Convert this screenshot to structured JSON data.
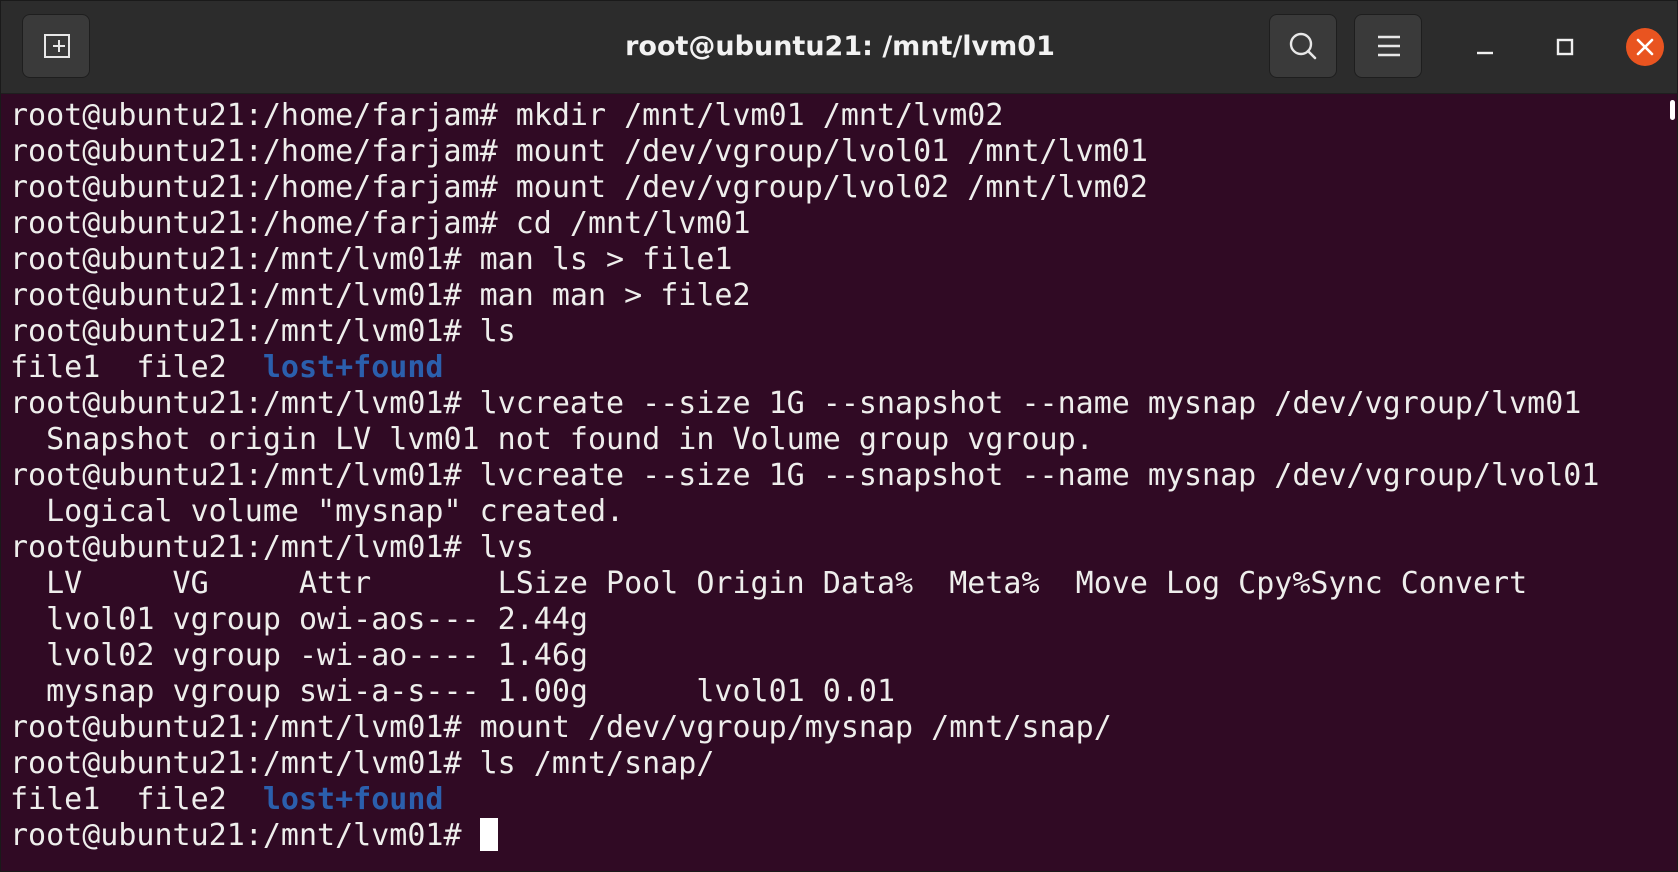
{
  "window": {
    "title": "root@ubuntu21: /mnt/lvm01"
  },
  "titlebar": {
    "new_tab_icon": "new-tab-icon",
    "search_icon": "search-icon",
    "menu_icon": "hamburger-menu-icon",
    "minimize_icon": "minimize-icon",
    "maximize_icon": "maximize-icon",
    "close_icon": "close-icon",
    "close_color": "#e95420"
  },
  "terminal": {
    "background": "#300a24",
    "foreground": "#eeeeec",
    "directory_color": "#2b5fad",
    "lines": [
      {
        "segments": [
          {
            "text": "root@ubuntu21:/home/farjam# mkdir /mnt/lvm01 /mnt/lvm02"
          }
        ]
      },
      {
        "segments": [
          {
            "text": "root@ubuntu21:/home/farjam# mount /dev/vgroup/lvol01 /mnt/lvm01"
          }
        ]
      },
      {
        "segments": [
          {
            "text": "root@ubuntu21:/home/farjam# mount /dev/vgroup/lvol02 /mnt/lvm02"
          }
        ]
      },
      {
        "segments": [
          {
            "text": "root@ubuntu21:/home/farjam# cd /mnt/lvm01"
          }
        ]
      },
      {
        "segments": [
          {
            "text": "root@ubuntu21:/mnt/lvm01# man ls > file1"
          }
        ]
      },
      {
        "segments": [
          {
            "text": "root@ubuntu21:/mnt/lvm01# man man > file2"
          }
        ]
      },
      {
        "segments": [
          {
            "text": "root@ubuntu21:/mnt/lvm01# ls"
          }
        ]
      },
      {
        "segments": [
          {
            "text": "file1  file2  "
          },
          {
            "text": "lost+found",
            "dir": true
          }
        ]
      },
      {
        "segments": [
          {
            "text": "root@ubuntu21:/mnt/lvm01# lvcreate --size 1G --snapshot --name mysnap /dev/vgroup/lvm01"
          }
        ]
      },
      {
        "segments": [
          {
            "text": "  Snapshot origin LV lvm01 not found in Volume group vgroup."
          }
        ]
      },
      {
        "segments": [
          {
            "text": "root@ubuntu21:/mnt/lvm01# lvcreate --size 1G --snapshot --name mysnap /dev/vgroup/lvol01"
          }
        ]
      },
      {
        "segments": [
          {
            "text": "  Logical volume \"mysnap\" created."
          }
        ]
      },
      {
        "segments": [
          {
            "text": "root@ubuntu21:/mnt/lvm01# lvs"
          }
        ]
      },
      {
        "segments": [
          {
            "text": "  LV     VG     Attr       LSize Pool Origin Data%  Meta%  Move Log Cpy%Sync Convert"
          }
        ]
      },
      {
        "segments": [
          {
            "text": "  lvol01 vgroup owi-aos--- 2.44g"
          }
        ]
      },
      {
        "segments": [
          {
            "text": "  lvol02 vgroup -wi-ao---- 1.46g"
          }
        ]
      },
      {
        "segments": [
          {
            "text": "  mysnap vgroup swi-a-s--- 1.00g      lvol01 0.01"
          }
        ]
      },
      {
        "segments": [
          {
            "text": "root@ubuntu21:/mnt/lvm01# mount /dev/vgroup/mysnap /mnt/snap/"
          }
        ]
      },
      {
        "segments": [
          {
            "text": "root@ubuntu21:/mnt/lvm01# ls /mnt/snap/"
          }
        ]
      },
      {
        "segments": [
          {
            "text": "file1  file2  "
          },
          {
            "text": "lost+found",
            "dir": true
          }
        ]
      },
      {
        "segments": [
          {
            "text": "root@ubuntu21:/mnt/lvm01# "
          }
        ],
        "cursor": true
      }
    ]
  }
}
